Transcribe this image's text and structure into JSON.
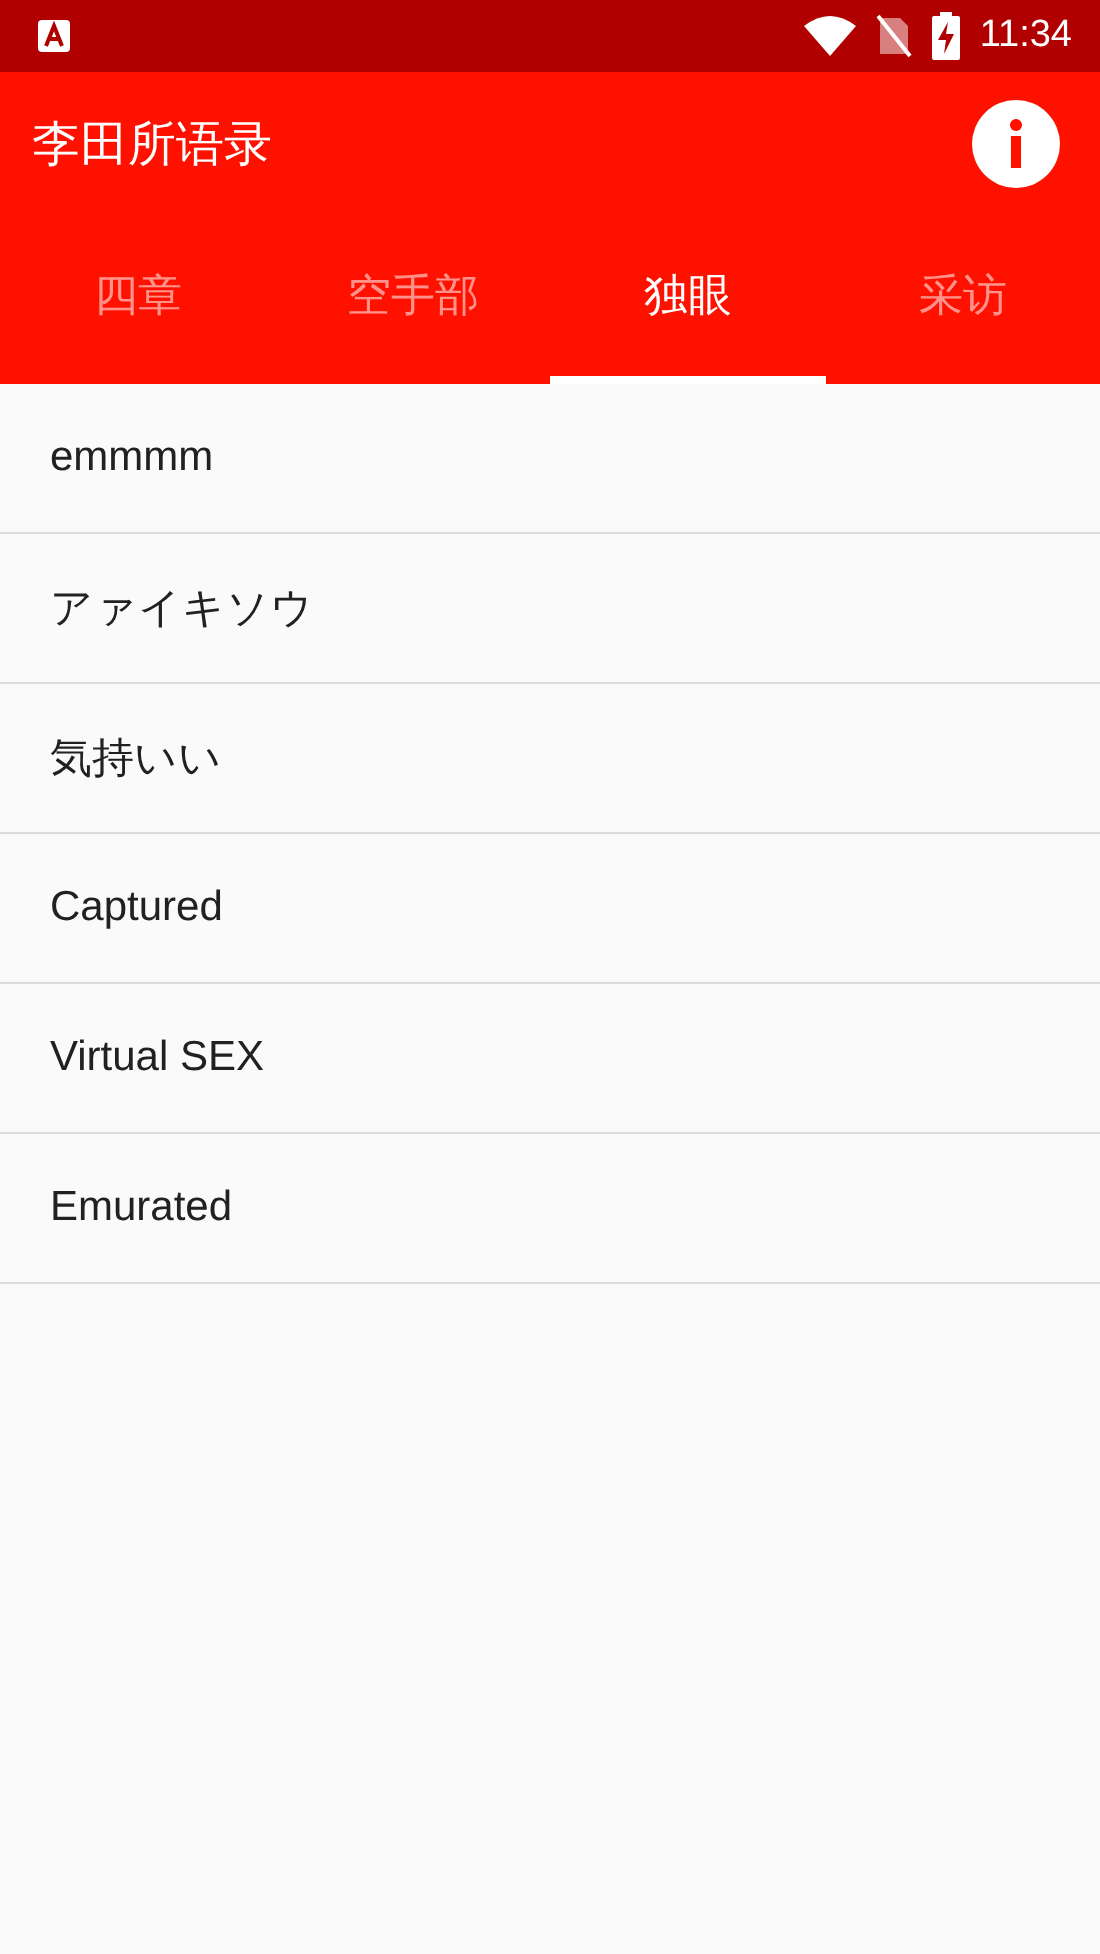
{
  "status_bar": {
    "time": "11:34"
  },
  "app_bar": {
    "title": "李田所语录"
  },
  "tabs": [
    {
      "label": "四章",
      "selected": false
    },
    {
      "label": "空手部",
      "selected": false
    },
    {
      "label": "独眼",
      "selected": true
    },
    {
      "label": "采访",
      "selected": false
    }
  ],
  "items": [
    "emmmm",
    "アァイキソウ",
    "気持いい",
    "Captured",
    "Virtual SEX",
    "Emurated"
  ]
}
